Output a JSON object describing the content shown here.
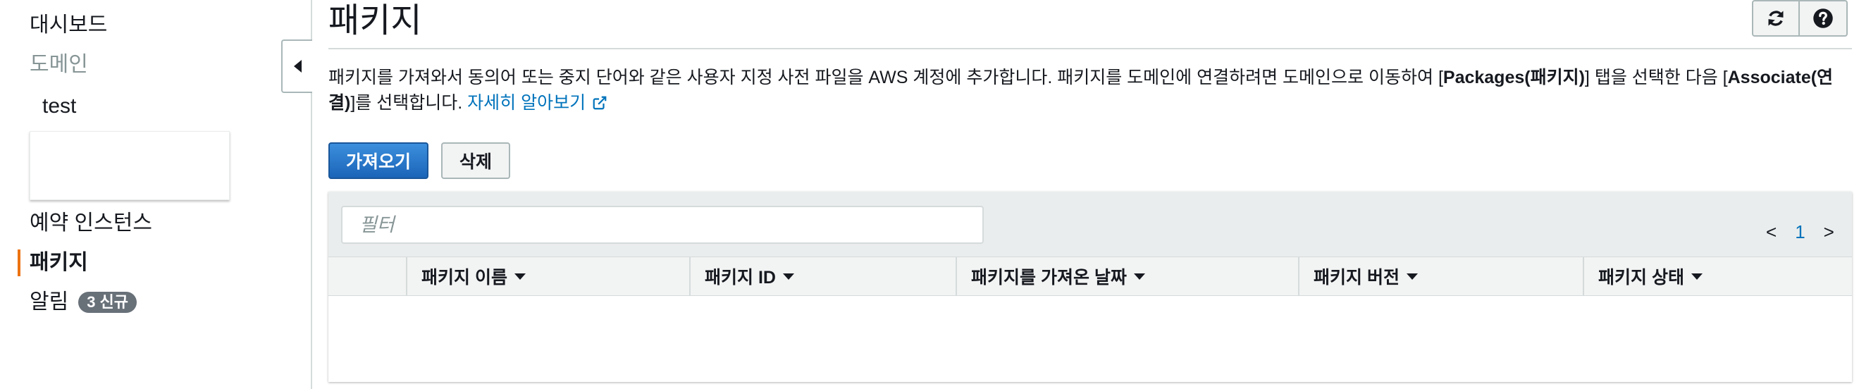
{
  "sidebar": {
    "dashboard": "대시보드",
    "domains_heading": "도메인",
    "domains": [
      "test"
    ],
    "reserved_instances": "예약 인스턴스",
    "packages": "패키지",
    "notifications": "알림",
    "notifications_badge": "3 신규"
  },
  "header": {
    "title": "패키지",
    "refresh_icon": "refresh-icon",
    "help_icon": "help-icon"
  },
  "description": {
    "part1": "패키지를 가져와서 동의어 또는 중지 단어와 같은 사용자 지정 사전 파일을 AWS 계정에 추가합니다. 패키지를 도메인에 연결하려면 도메인으로 이동하여 [",
    "packages_tab": "Packages(패키지)",
    "part2": "] 탭을 선택한 다음 [",
    "associate": "Associate(연결)",
    "part3": "]를 선택합니다. ",
    "learn_more": "자세히 알아보기"
  },
  "actions": {
    "import_label": "가져오기",
    "delete_label": "삭제"
  },
  "table": {
    "filter_placeholder": "필터",
    "pagination": {
      "prev": "<",
      "current": "1",
      "next": ">"
    },
    "columns": {
      "name": "패키지 이름",
      "id": "패키지 ID",
      "imported_date": "패키지를 가져온 날짜",
      "version": "패키지 버전",
      "status": "패키지 상태"
    },
    "rows": []
  },
  "colors": {
    "accent": "#ec7211",
    "primary_button": "#1e73be",
    "link": "#0073bb",
    "badge": "#687078"
  }
}
